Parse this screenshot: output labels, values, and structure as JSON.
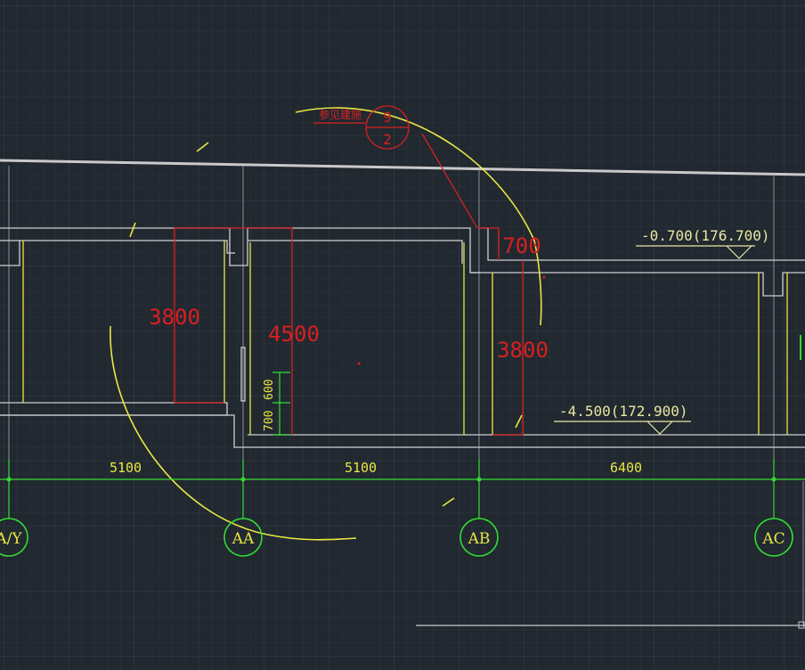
{
  "colors": {
    "background": "#212830",
    "grid_minor": "#2b333c",
    "grid_major": "#343d47",
    "outline": "#c9c9c9",
    "accent_yellow": "#e8e840",
    "dimension_green": "#33dd33",
    "annotation_red": "#d82020",
    "elevation_label": "#e8e8a0"
  },
  "drawing": {
    "detail_callout": {
      "note": "参见建施",
      "detail_number": "9",
      "sheet_number": "2"
    },
    "depths": {
      "left_pit": "3800",
      "middle_pit": "4500",
      "right_pit_step": "700",
      "right_pit": "3800"
    },
    "small_dims": {
      "upper": "600",
      "lower": "700"
    },
    "elevations": {
      "top": "-0.700(176.700)",
      "bottom": "-4.500(172.900)"
    },
    "bay_dimensions": [
      "5100",
      "5100",
      "6400"
    ],
    "axis_labels": {
      "y": "A/Y",
      "aa": "AA",
      "ab": "AB",
      "ac": "AC"
    }
  }
}
